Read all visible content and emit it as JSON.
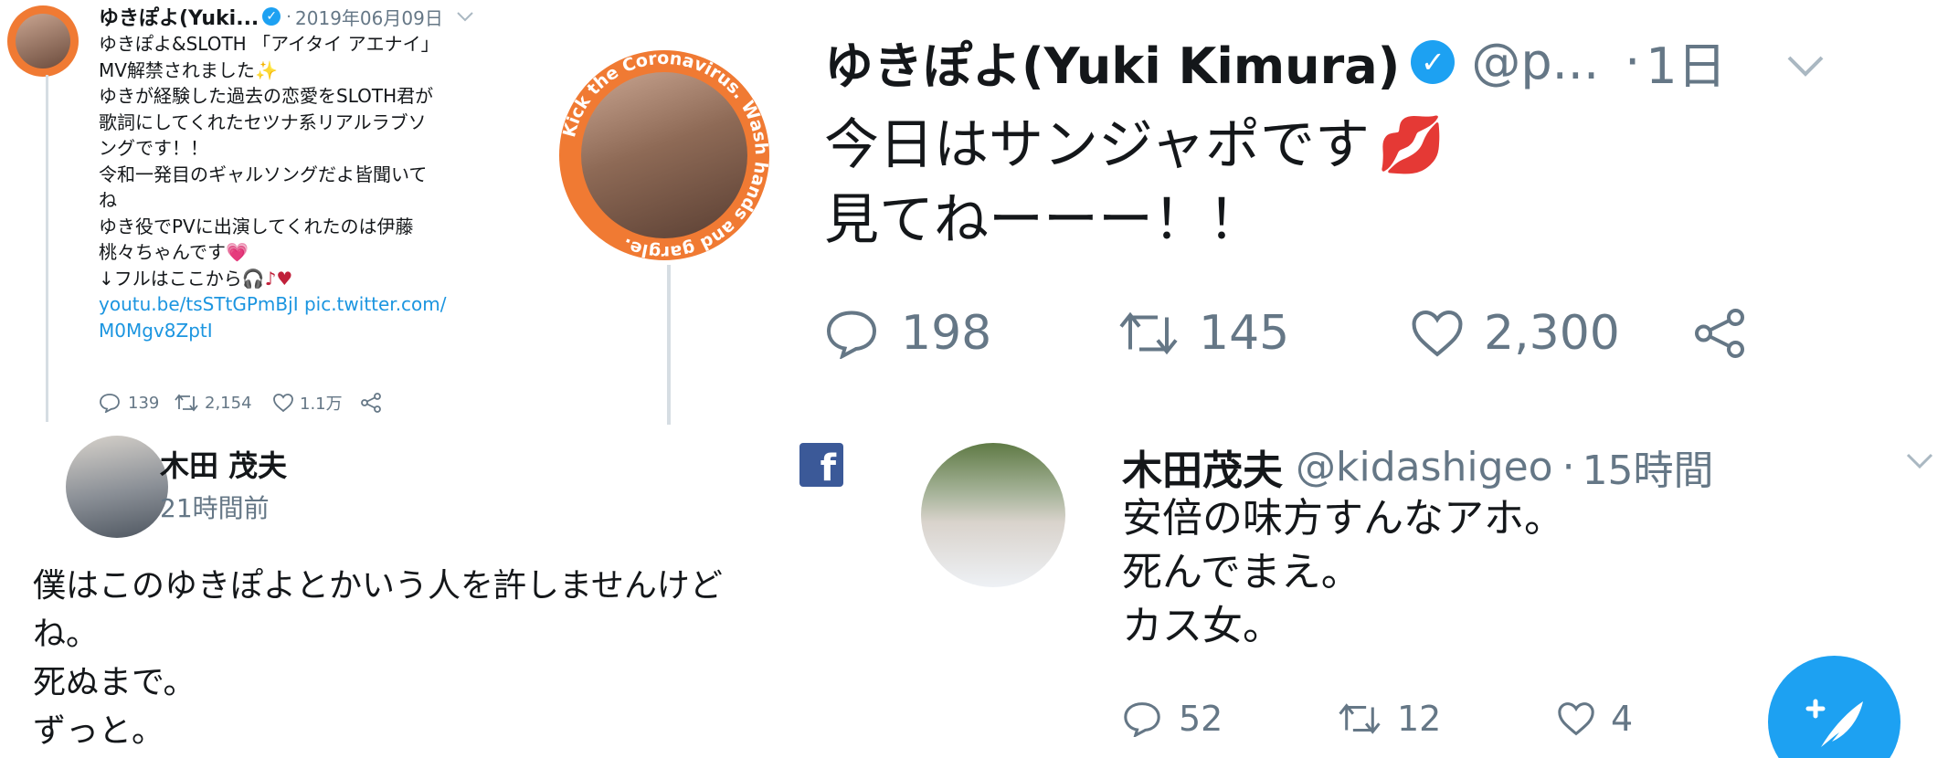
{
  "tweet_a": {
    "author": "ゆきぽよ(Yuki...",
    "separator": "·",
    "date": "2019年06月09日",
    "lines": [
      "ゆきぽよ&SLOTH 「アイタイ アエナイ」",
      "MV解禁されました",
      "ゆきが経験した過去の恋愛をSLOTH君が",
      "歌詞にしてくれたセツナ系リアルラブソ",
      "ングです！！",
      "令和一発目のギャルソングだよ皆聞いて",
      "ね",
      "ゆき役でPVに出演してくれたのは伊藤",
      "桃々ちゃんです",
      "↓フルはここから"
    ],
    "link_line1": "youtu.be/tsSTtGPmBjI pic.twitter.com/",
    "link_line2": "M0Mgv8ZptI",
    "replies": "139",
    "retweets": "2,154",
    "likes": "1.1万"
  },
  "tweet_b": {
    "badge_text": "Kick the Coronavirus. Wash hands and gargle.",
    "author": "ゆきぽよ(Yuki Kimura)",
    "handle": "@p...",
    "separator": "·",
    "time": "1日",
    "line1": "今日はサンジャポです",
    "line2": "見てねーーー！！",
    "replies": "198",
    "retweets": "145",
    "likes": "2,300"
  },
  "fb_post": {
    "author": "木田 茂夫",
    "time": "21時間前",
    "lines": [
      "僕はこのゆきぽよとかいう人を許しませんけど",
      "ね。",
      "死ぬまで。",
      "ずっと。"
    ]
  },
  "tweet_d": {
    "author": "木田茂夫",
    "handle": "@kidashigeo",
    "separator": "·",
    "time": "15時間",
    "lines": [
      "安倍の味方すんなアホ。",
      "死んでまえ。",
      "カス女。"
    ],
    "replies": "52",
    "retweets": "12",
    "likes": "4"
  },
  "colors": {
    "twitter_blue": "#1da1f2",
    "link_blue": "#1b95e0",
    "facebook_blue": "#3b5998",
    "badge_orange": "#f07a33",
    "grey": "#657786"
  },
  "icons": [
    "verified-badge-icon",
    "chevron-down-icon",
    "reply-icon",
    "retweet-icon",
    "like-icon",
    "share-icon",
    "facebook-icon",
    "compose-tweet-icon",
    "lips-emoji-icon",
    "heart-emoji-icon"
  ]
}
